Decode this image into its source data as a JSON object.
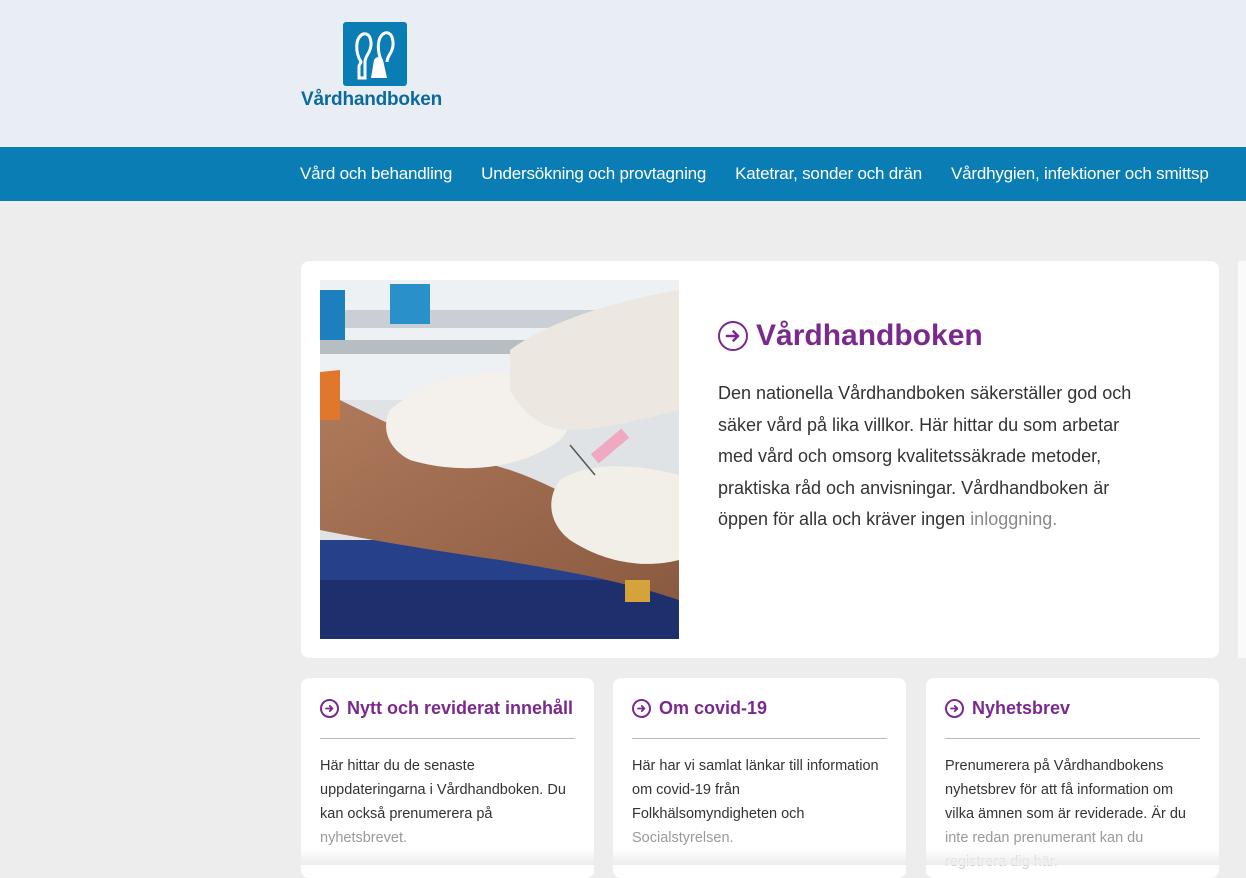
{
  "header": {
    "logo_text": "Vårdhandboken",
    "brand_color": "#0a7db4"
  },
  "nav": {
    "items": [
      "Vård och behandling",
      "Undersökning och provtagning",
      "Katetrar, sonder och drän",
      "Vårdhygien, infektioner och smittsp"
    ]
  },
  "hero": {
    "image_icon": "blood-sample-photo",
    "title": "Vårdhandboken",
    "text_main": "Den nationella Vårdhandboken säkerställer god och säker vård på lika villkor. Här hittar du som arbetar med vård och omsorg kvalitetssäkrade metoder, praktiska råd och anvisningar. Vårdhandboken är öppen för alla och kräver ingen",
    "text_fade": "inloggning."
  },
  "cards": [
    {
      "title": "Nytt och reviderat innehåll",
      "text_main": "Här hittar du de senaste uppdateringarna i Vårdhandboken. Du kan också prenumerera på",
      "text_fade": "nyhetsbrevet.",
      "text_fade2": ""
    },
    {
      "title": "Om covid-19",
      "text_main": "Här har vi samlat länkar till information om covid-19 från Folkhälsomyndigheten och",
      "text_fade": "Socialstyrelsen.",
      "text_fade2": ""
    },
    {
      "title": "Nyhetsbrev",
      "text_main": "Prenumerera på Vårdhandbokens nyhetsbrev för att få information om vilka ämnen som är reviderade. Är du",
      "text_fade": "inte redan prenumerant kan du",
      "text_fade2": "registrera dig här."
    }
  ],
  "colors": {
    "accent": "#7a2a8c",
    "header_bg": "#e9eef4",
    "nav_bg": "#0a7db4",
    "page_bg": "#ededed"
  }
}
